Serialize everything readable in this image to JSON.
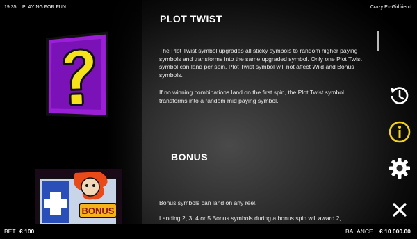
{
  "topbar": {
    "time": "19:35",
    "mode": "PLAYING FOR FUN",
    "game_title": "Crazy Ex-Girlfriend"
  },
  "sections": {
    "plot_twist": {
      "title": "PLOT TWIST",
      "para1": "The Plot Twist symbol upgrades all sticky symbols to random higher paying symbols and transforms into the same upgraded symbol. Only one Plot Twist symbol can land per spin. Plot Twist symbol will not affect Wild and Bonus symbols.",
      "para2": "If no winning combinations land on the first spin, the Plot Twist symbol transforms into a random mid paying symbol."
    },
    "bonus": {
      "title": "BONUS",
      "para1": "Bonus symbols can land on any reel.",
      "para2": "Landing 2, 3, 4 or 5 Bonus symbols during a bonus spin will award 2,",
      "badge": "BONUS"
    }
  },
  "side_icons": [
    "history-icon",
    "info-icon",
    "settings-icon",
    "close-icon"
  ],
  "bottombar": {
    "bet_label": "BET",
    "bet_value": "€ 100",
    "balance_label": "BALANCE",
    "balance_value": "€ 10 000.00"
  },
  "colors": {
    "info_accent": "#f2d21b",
    "symbol_purple": "#9b1fd6",
    "symbol_yellow": "#f5e21a"
  }
}
